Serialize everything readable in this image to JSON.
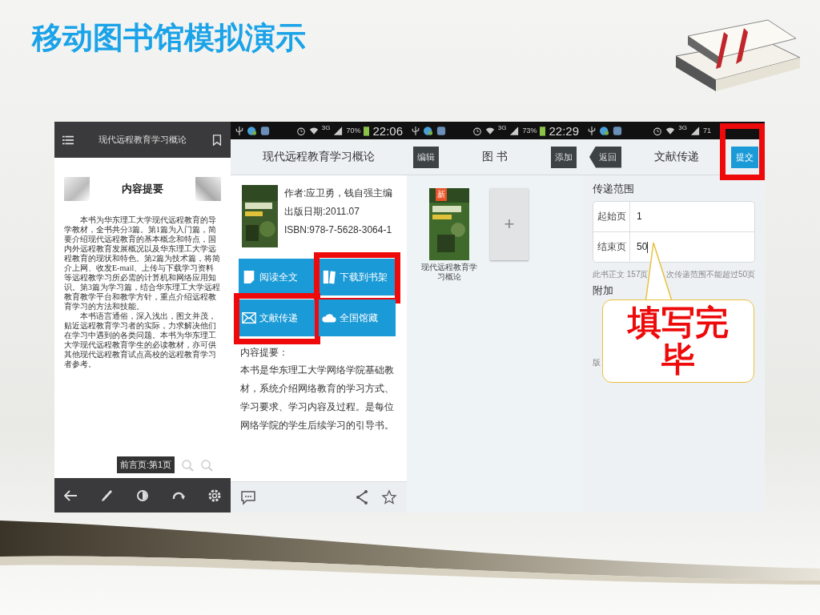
{
  "slide": {
    "title": "移动图书馆模拟演示"
  },
  "reader": {
    "title": "现代远程教育学习概论",
    "heading": "内容提要",
    "paragraphs": [
      "本书为华东理工大学现代远程教育的导学教材，全书共分3篇。第1篇为入门篇，简要介绍现代远程教育的基本概念和特点，国内外远程教育发展概况以及华东理工大学远程教育的现状和特色。第2篇为技术篇，将简介上网、收发E-mail、上传与下载学习资料等远程教学习所必需的计算机和网络应用知识。第3篇为学习篇，结合华东理工大学远程教育教学平台和教学方针，重点介绍远程教育学习的方法和技能。",
      "本书语言通俗，深入浅出，图文并茂，贴近远程教育学习者的实际，力求解决他们在学习中遇到的各类问题。本书为华东理工大学现代远程教育学生的必读教材，亦可供其他现代远程教育试点高校的远程教育学习者参考。"
    ],
    "tooltip": "前言页:第1页"
  },
  "detail": {
    "status": {
      "net": "3G",
      "battery": "70%",
      "time": "22:06"
    },
    "title": "现代远程教育学习概论",
    "info": [
      "作者:应卫勇，钱自强主编",
      "出版日期:2011.07",
      "ISBN:978-7-5628-3064-1"
    ],
    "actions": [
      {
        "kind": "page",
        "label": "阅读全文",
        "highlighted": false
      },
      {
        "kind": "books",
        "label": "下载到书架",
        "highlighted": true
      },
      {
        "kind": "mail",
        "label": "文献传递",
        "highlighted": true
      },
      {
        "kind": "cloud",
        "label": "全国馆藏",
        "highlighted": false
      }
    ],
    "summary_label": "内容提要：",
    "summary": "本书是华东理工大学网络学院基础教材，系统介绍网络教育的学习方式、学习要求、学习内容及过程。是每位网络学院的学生后续学习的引导书。"
  },
  "shelf": {
    "status": {
      "net": "3G",
      "battery": "73%",
      "time": "22:29"
    },
    "edit_button": "编辑",
    "title": "图 书",
    "add_button": "添加",
    "books": [
      {
        "badge": "新",
        "caption": "现代远程教育学习概论"
      }
    ],
    "add_tile": "+"
  },
  "delivery": {
    "status": {
      "net": "3G",
      "battery": "71"
    },
    "back_button": "返回",
    "title": "文献传递",
    "submit_button": "提交",
    "submit_highlighted": true,
    "section": "传递范围",
    "fields": [
      {
        "label": "起始页",
        "value": "1"
      },
      {
        "label": "结束页",
        "value": "50"
      }
    ],
    "note_start": "此书正文 157页",
    "note_end": "次传递范围不能超过50页",
    "section2": "附加",
    "footnote": "版"
  },
  "callout": "填写完毕"
}
